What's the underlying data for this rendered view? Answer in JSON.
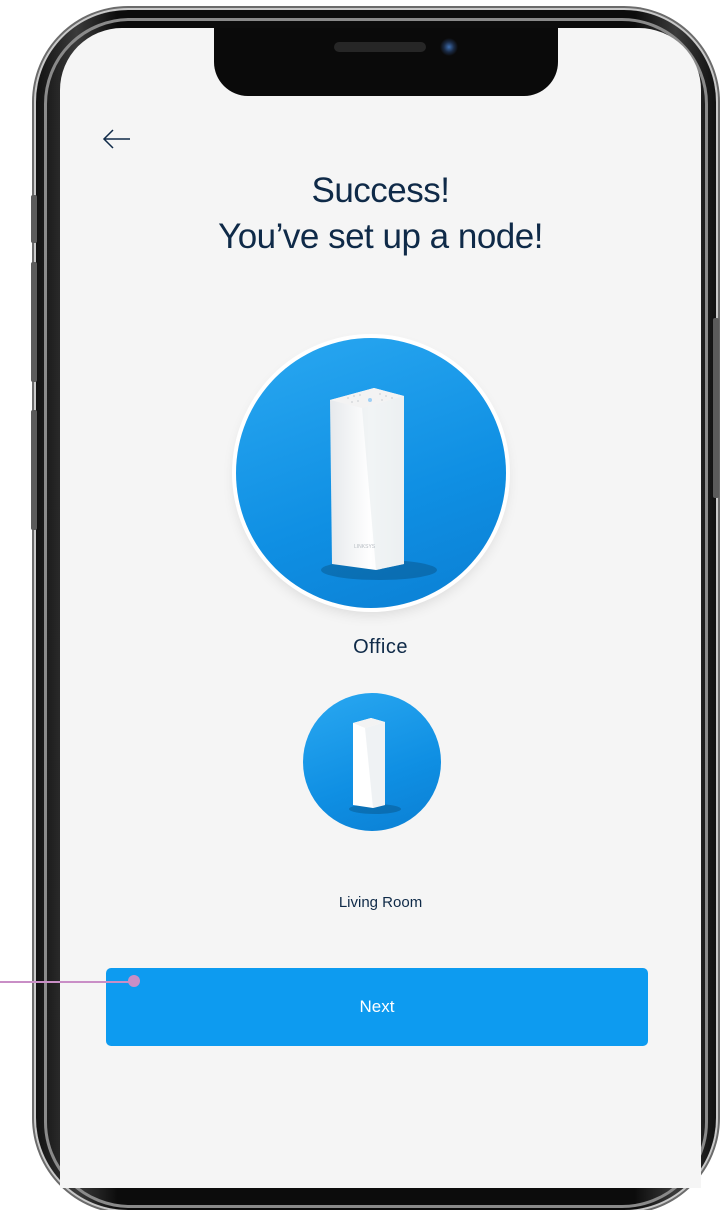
{
  "screen": {
    "title_line1": "Success!",
    "title_line2": "You’ve set up a node!",
    "primary_node": {
      "name": "Office"
    },
    "secondary_node": {
      "name": "Living Room"
    },
    "next_button_label": "Next"
  },
  "icons": {
    "back": "arrow-left-icon",
    "device": "mesh-router-node"
  },
  "colors": {
    "accent": "#0d9bf0",
    "title_text": "#0f2a48",
    "screen_background": "#f5f5f5",
    "callout": "#c98ec6"
  }
}
